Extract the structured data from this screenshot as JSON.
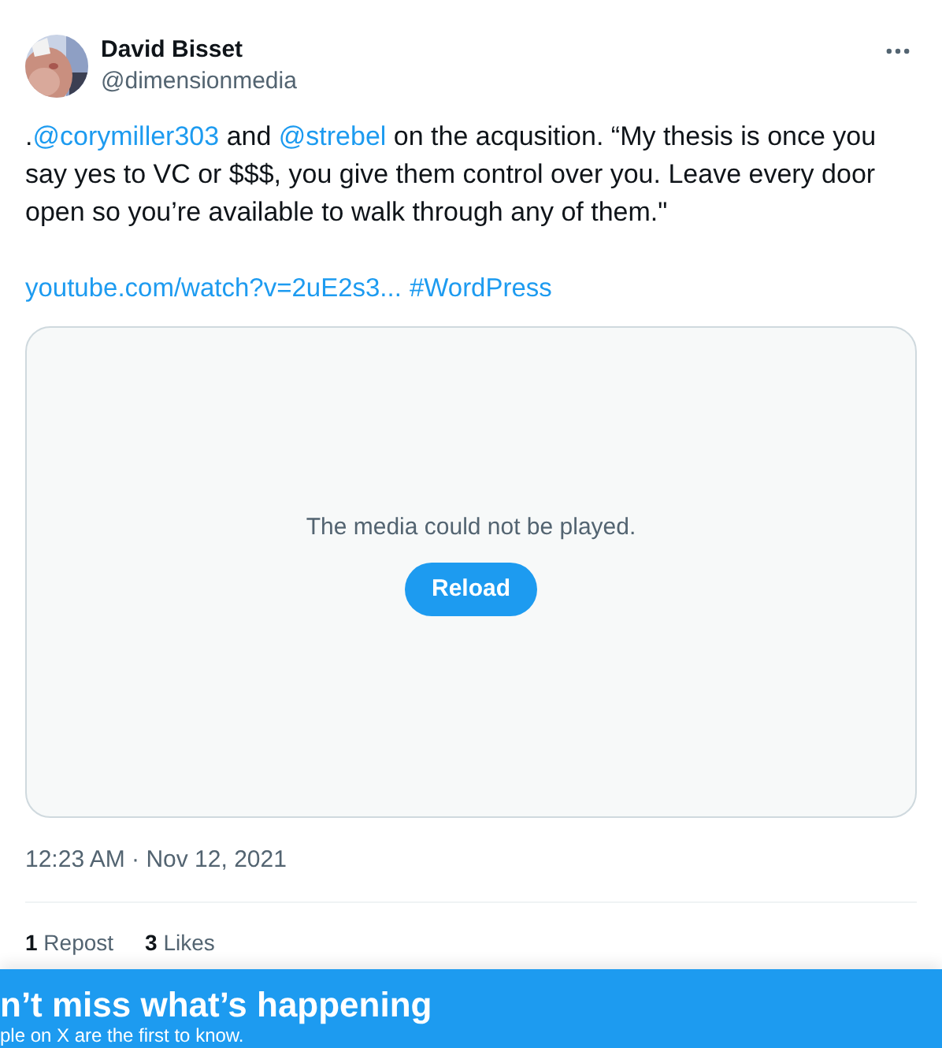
{
  "author": {
    "name": "David Bisset",
    "handle": "@dimensionmedia"
  },
  "body": [
    {
      "kind": "text",
      "text": "."
    },
    {
      "kind": "mention",
      "text": "@corymiller303"
    },
    {
      "kind": "text",
      "text": " and "
    },
    {
      "kind": "mention",
      "text": "@strebel"
    },
    {
      "kind": "text",
      "text": " on the acqusition. “My thesis is once you say yes to VC or $$$, you give them control over you. Leave every door open so you’re available to walk through any of them.\""
    }
  ],
  "links": [
    "youtube.com/watch?v=2uE2s3...",
    "#WordPress"
  ],
  "media": {
    "message": "The media could not be played.",
    "button": "Reload"
  },
  "timestamp": "12:23 AM · Nov 12, 2021",
  "stats": [
    {
      "count": "1",
      "label": "Repost"
    },
    {
      "count": "3",
      "label": "Likes"
    }
  ],
  "banner": {
    "title": "n’t miss what’s happening",
    "subtitle": "ple on X are the first to know."
  }
}
